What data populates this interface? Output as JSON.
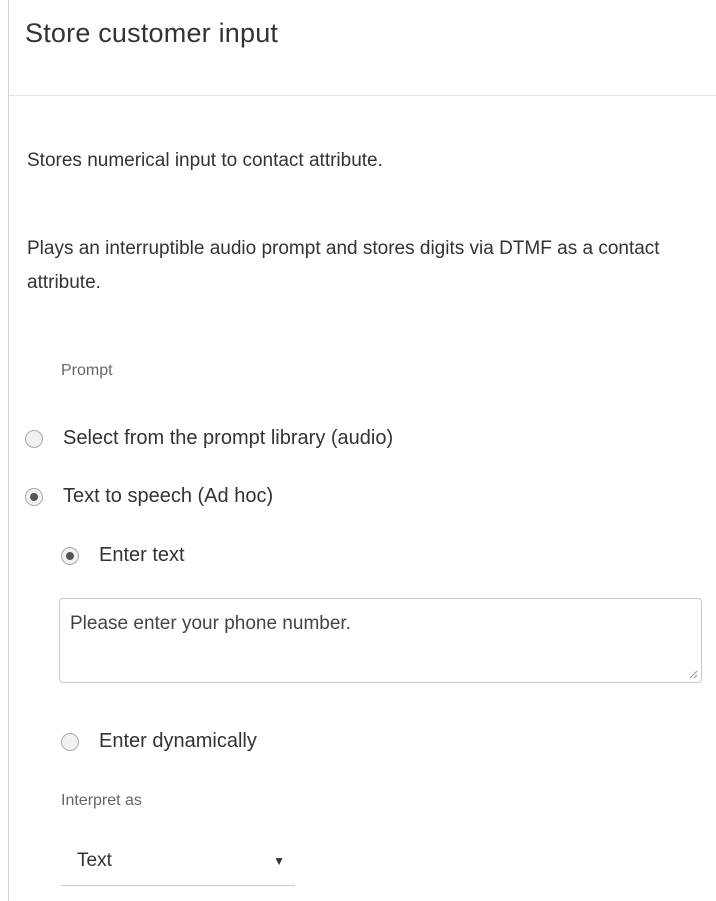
{
  "header": {
    "title": "Store customer input"
  },
  "description": {
    "short": "Stores numerical input to contact attribute.",
    "long": "Plays an interruptible audio prompt and stores digits via DTMF as a contact attribute."
  },
  "prompt": {
    "label": "Prompt",
    "options": [
      {
        "label": "Select from the prompt library (audio)",
        "checked": false
      },
      {
        "label": "Text to speech (Ad hoc)",
        "checked": true
      }
    ],
    "tts": {
      "enter_text": {
        "label": "Enter text",
        "checked": true
      },
      "text_value": "Please enter your phone number.",
      "enter_dynamically": {
        "label": "Enter dynamically",
        "checked": false
      }
    }
  },
  "interpret_as": {
    "label": "Interpret as",
    "selected": "Text"
  }
}
